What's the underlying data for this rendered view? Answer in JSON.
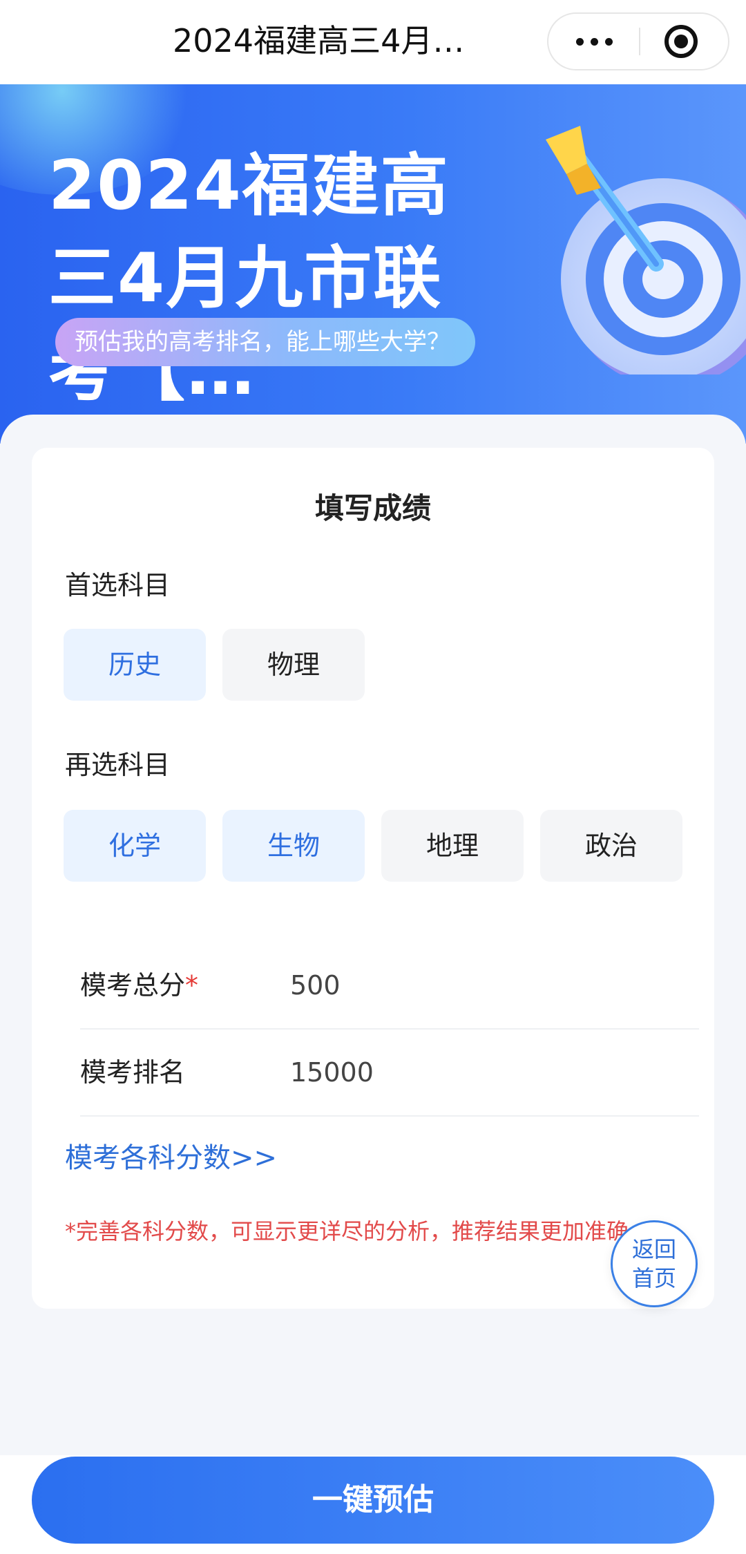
{
  "navbar": {
    "title": "2024福建高三4月…",
    "more_icon": "more-dots-icon",
    "close_icon": "target-close-icon"
  },
  "hero": {
    "title": "2024福建高三4月九市联考【…",
    "subtitle": "预估我的高考排名，能上哪些大学？",
    "illustration_icon": "dart-target-icon"
  },
  "form": {
    "title": "填写成绩",
    "primary_subject": {
      "label": "首选科目",
      "options": [
        {
          "label": "历史",
          "selected": true
        },
        {
          "label": "物理",
          "selected": false
        }
      ]
    },
    "secondary_subject": {
      "label": "再选科目",
      "options": [
        {
          "label": "化学",
          "selected": true
        },
        {
          "label": "生物",
          "selected": true
        },
        {
          "label": "地理",
          "selected": false
        },
        {
          "label": "政治",
          "selected": false
        }
      ]
    },
    "total_score": {
      "label": "模考总分",
      "required_mark": "*",
      "value": "500"
    },
    "rank": {
      "label": "模考排名",
      "value": "15000"
    },
    "subject_scores_link": "模考各科分数>>",
    "note": "*完善各科分数，可显示更详尽的分析，推荐结果更加准确"
  },
  "home_button": {
    "line1": "返回",
    "line2": "首页"
  },
  "submit_button": {
    "label": "一键预估"
  },
  "colors": {
    "accent": "#2f6fe0",
    "selected_bg": "#eaf3ff",
    "warning": "#e24a4a"
  }
}
